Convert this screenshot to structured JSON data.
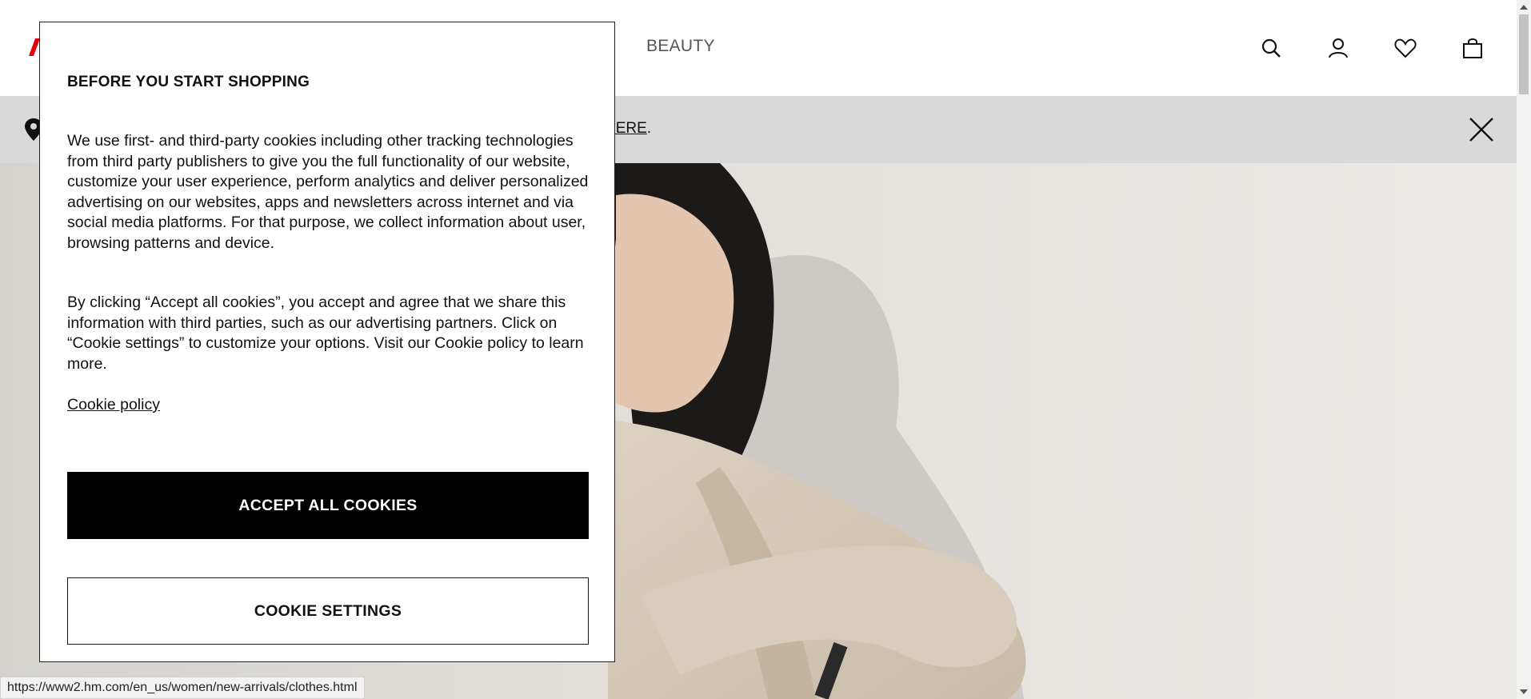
{
  "header": {
    "nav_beauty": "BEAUTY",
    "icons": [
      "search-icon",
      "account-icon",
      "favorites-icon",
      "shopping-bag-icon"
    ],
    "brand_color": "#e50010"
  },
  "notice": {
    "link_text": "HERE",
    "trailing_text": "."
  },
  "cookie_modal": {
    "title": "BEFORE YOU START SHOPPING",
    "paragraph_1": "We use first- and third-party cookies including other tracking technologies from third party publishers to give you the full functionality of our website, customize your user experience, perform analytics and deliver personalized advertising on our websites, apps and newsletters across internet and via social media platforms. For that purpose, we collect information about user, browsing patterns and device.",
    "paragraph_2": "By clicking “Accept all cookies”, you accept and agree that we share this information with third parties, such as our advertising partners. Click on “Cookie settings” to customize your options. Visit our Cookie policy to learn more.",
    "cookie_policy_link": "Cookie policy",
    "accept_button": "ACCEPT ALL COOKIES",
    "settings_button": "COOKIE SETTINGS"
  },
  "status_bar": {
    "url": "https://www2.hm.com/en_us/women/new-arrivals/clothes.html"
  }
}
